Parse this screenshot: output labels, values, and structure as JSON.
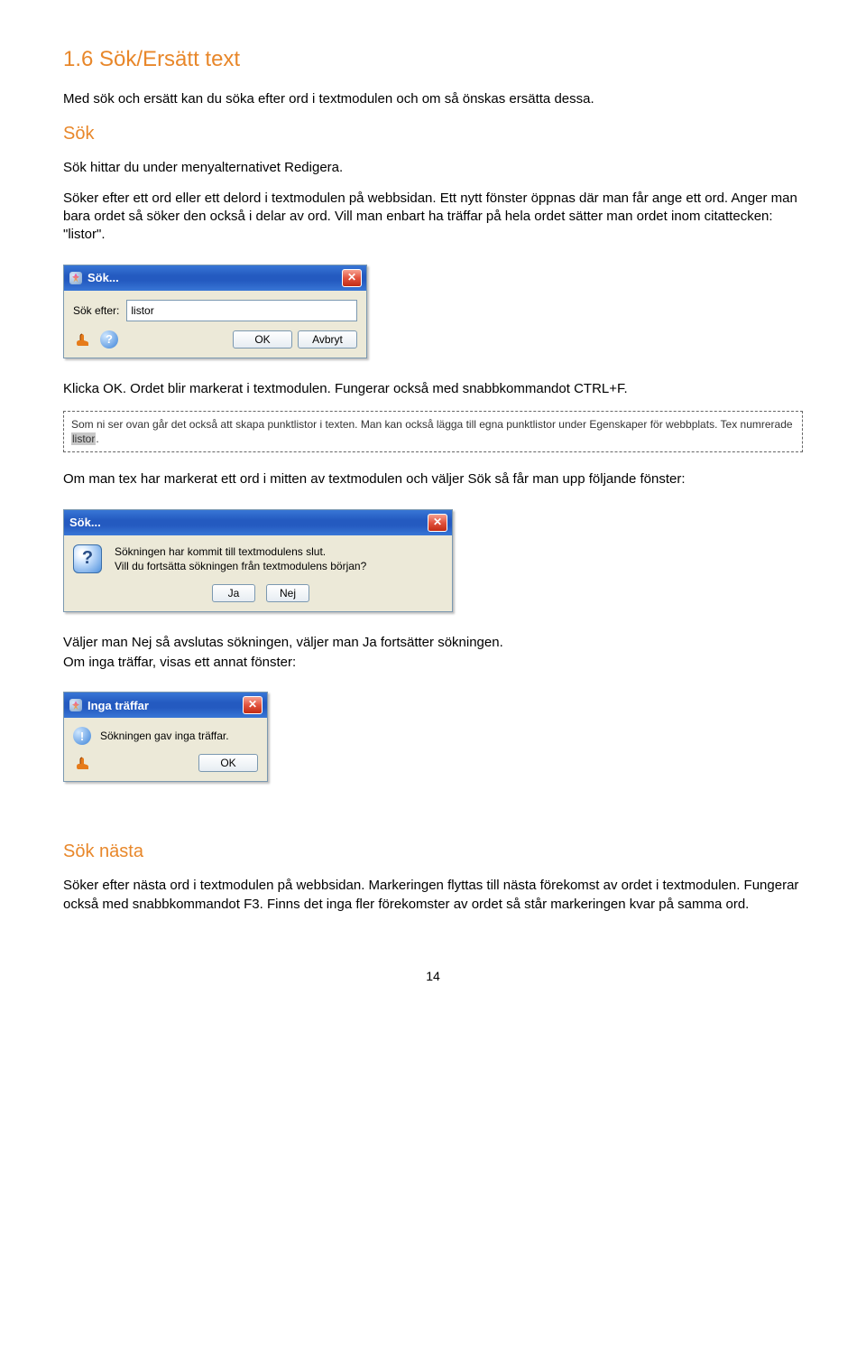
{
  "h_main": "1.6 Sök/Ersätt text",
  "p_intro": "Med sök och ersätt kan du söka efter ord i textmodulen och om så önskas ersätta dessa.",
  "h_sok": "Sök",
  "p_sok1": "Sök hittar du under menyalternativet Redigera.",
  "p_sok2": "Söker efter ett ord eller ett delord i textmodulen på webbsidan. Ett nytt fönster öppnas där man får ange ett ord. Anger man bara ordet så söker den också i delar av ord. Vill man enbart ha träffar på hela ordet sätter man ordet inom citattecken: \"listor\".",
  "dlg1": {
    "title": "Sök...",
    "label": "Sök efter:",
    "value": "listor",
    "ok": "OK",
    "cancel": "Avbryt"
  },
  "p_click_ok": "Klicka OK. Ordet blir markerat i textmodulen. Fungerar också med snabbkommandot CTRL+F.",
  "seltext1": "Som ni ser ovan går det också att skapa punktlistor i texten. Man kan också lägga till egna punktlistor under Egenskaper för webbplats. Tex numrerade ",
  "selword": "listor",
  "seltext2": ".",
  "p_middle": "Om man tex har markerat ett ord i mitten av textmodulen och väljer Sök så får man upp följande fönster:",
  "dlg2": {
    "title": "Sök...",
    "line1": "Sökningen har kommit till textmodulens slut.",
    "line2": "Vill du fortsätta sökningen från textmodulens början?",
    "yes": "Ja",
    "no": "Nej"
  },
  "p_choose": "Väljer man Nej så avslutas sökningen, väljer man Ja fortsätter sökningen.",
  "p_no_hits": "Om inga träffar, visas ett annat fönster:",
  "dlg3": {
    "title": "Inga träffar",
    "msg": "Sökningen gav inga träffar.",
    "ok": "OK"
  },
  "h_next": "Sök nästa",
  "p_next": "Söker efter nästa ord i textmodulen på webbsidan. Markeringen flyttas till nästa förekomst av ordet i textmodulen. Fungerar också med snabbkommandot F3. Finns det inga fler förekomster av ordet så står markeringen kvar på samma ord.",
  "page_no": "14"
}
